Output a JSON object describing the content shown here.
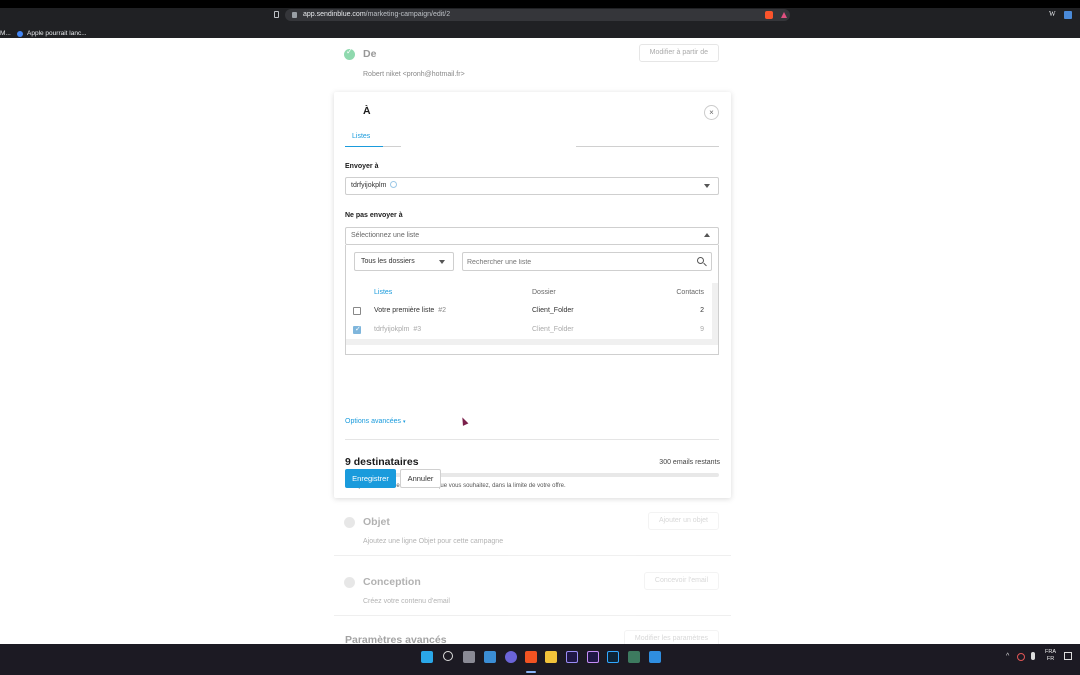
{
  "browser": {
    "url_host": "app.sendinblue.com",
    "url_path": "/marketing-campaign/edit/2",
    "bookmarks": [
      {
        "label": "M..."
      },
      {
        "label": "Apple pourrait lanc..."
      }
    ]
  },
  "steps": {
    "from": {
      "title": "De",
      "subtitle": "Robert niket <pronh@hotmail.fr>",
      "button": "Modifier à partir de"
    },
    "subject": {
      "title": "Objet",
      "subtitle": "Ajoutez une ligne Objet pour cette campagne",
      "button": "Ajouter un objet"
    },
    "design": {
      "title": "Conception",
      "subtitle": "Créez votre contenu d'email",
      "button": "Concevoir l'email"
    },
    "advanced": {
      "title": "Paramètres avancés",
      "button": "Modifier les paramètres"
    }
  },
  "to_card": {
    "title": "À",
    "tab_lists": "Listes",
    "send_to_label": "Envoyer à",
    "send_to_chip": "tdrfyijokplm",
    "exclude_label": "Ne pas envoyer à",
    "exclude_placeholder": "Sélectionnez une liste",
    "folder_filter": "Tous les dossiers",
    "search_placeholder": "Rechercher une liste",
    "table": {
      "headers": [
        "Listes",
        "Dossier",
        "Contacts"
      ],
      "rows": [
        {
          "name": "Votre première liste",
          "id": "#2",
          "folder": "Client_Folder",
          "contacts": "2",
          "checked": false
        },
        {
          "name": "tdrfyijokplm",
          "id": "#3",
          "folder": "Client_Folder",
          "contacts": "9",
          "checked": true
        }
      ]
    },
    "advanced_options": "Options avancées",
    "recipients": "9 destinataires",
    "emails_remaining": "300 emails restants",
    "progress_fraction": 0.03,
    "note": "Envoyez à autant de destinataires que vous souhaitez, dans la limite de votre offre.",
    "save_button": "Enregistrer",
    "cancel_button": "Annuler"
  },
  "taskbar": {
    "language": "FRA",
    "region": "FR"
  },
  "colors": {
    "accent": "#1a9bdc",
    "check_green": "#3fbf74",
    "progress": "#1a9bdc"
  }
}
